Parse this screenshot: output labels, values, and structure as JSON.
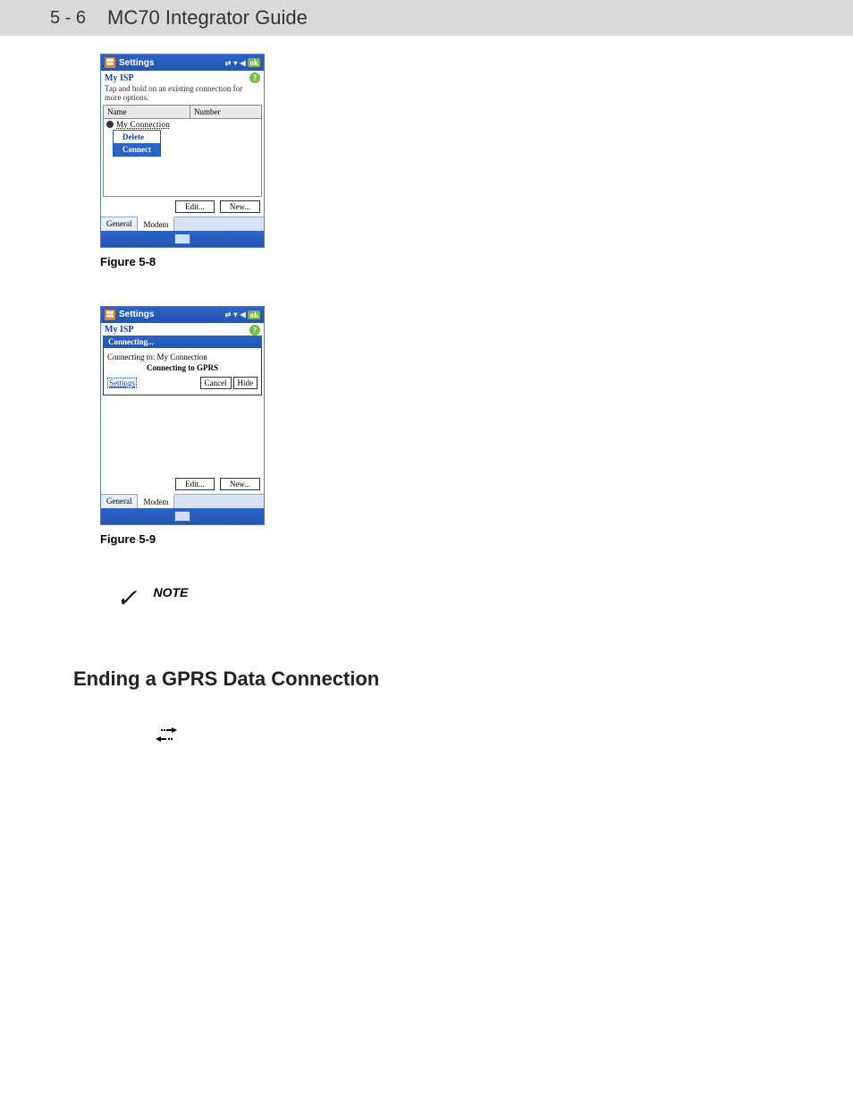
{
  "header": {
    "page_number": "5 - 6",
    "title": "MC70 Integrator Guide"
  },
  "figure_5_8": {
    "caption": "Figure 5-8",
    "top_bar": {
      "title": "Settings",
      "ok": "ok"
    },
    "subtitle": "My ISP",
    "hint": "Tap and hold on an existing connection for more options.",
    "columns": {
      "name": "Name",
      "number": "Number"
    },
    "row_label": "My Connection",
    "context_menu": {
      "delete": "Delete",
      "connect": "Connect"
    },
    "buttons": {
      "edit": "Edit...",
      "new": "New..."
    },
    "tabs": {
      "general": "General",
      "modem": "Modem"
    }
  },
  "figure_5_9": {
    "caption": "Figure 5-9",
    "top_bar": {
      "title": "Settings",
      "ok": "ok"
    },
    "subtitle": "My ISP",
    "popup_title": "Connecting...",
    "line1": "Connecting to: My Connection",
    "line2": "Connecting to GPRS",
    "settings_link": "Settings",
    "buttons": {
      "cancel": "Cancel",
      "hide": "Hide",
      "edit": "Edit...",
      "new": "New..."
    },
    "tabs": {
      "general": "General",
      "modem": "Modem"
    }
  },
  "note": {
    "label": "NOTE"
  },
  "section_heading": "Ending a GPRS Data Connection"
}
